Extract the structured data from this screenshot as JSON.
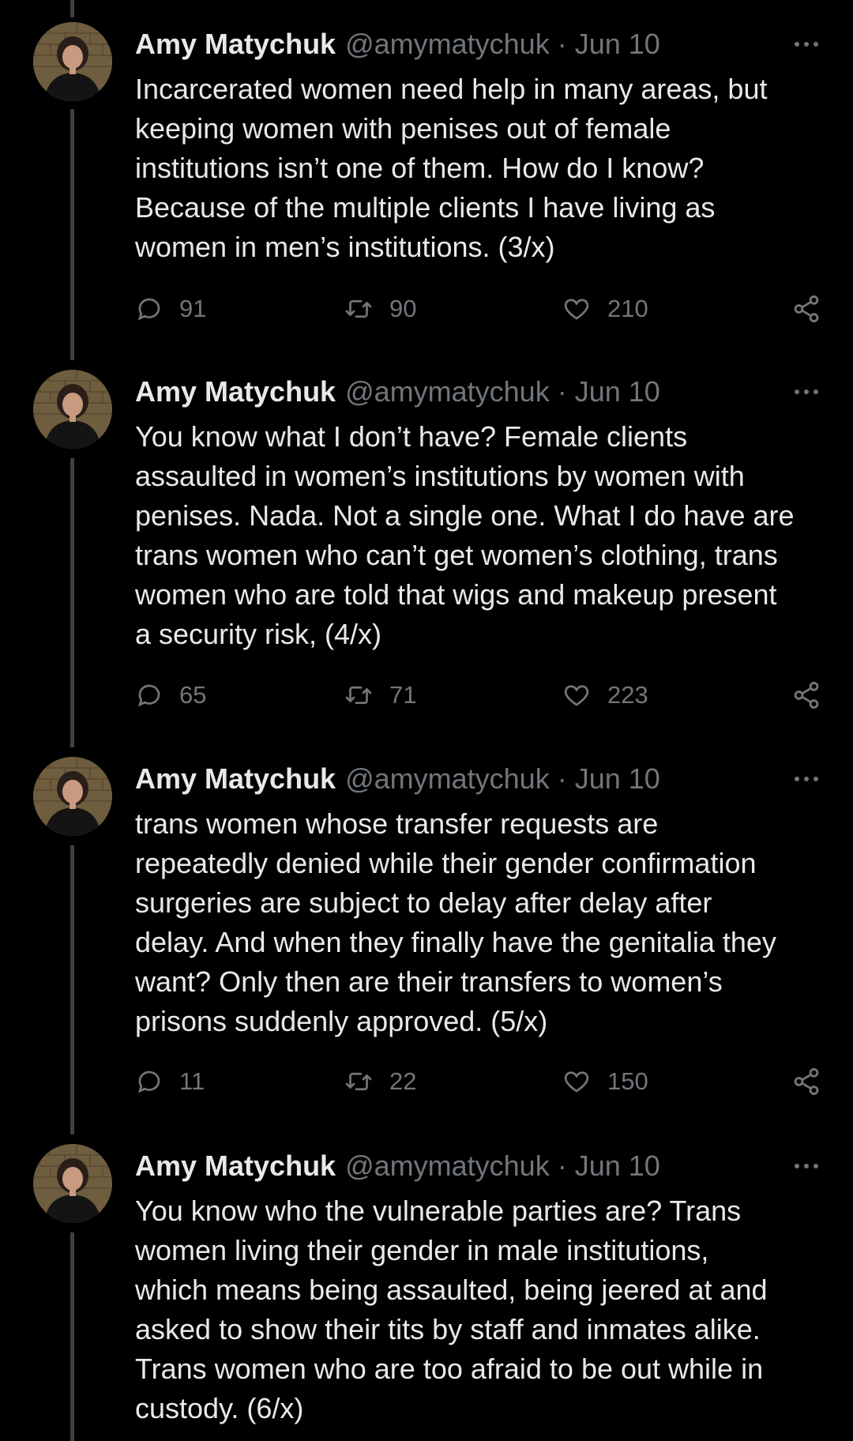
{
  "colors": {
    "background": "#000000",
    "text_primary": "#e7e9ea",
    "text_secondary": "#71767b",
    "thread_line": "#3e4144"
  },
  "icons": {
    "reply": "reply-bubble-icon",
    "retweet": "retweet-arrows-icon",
    "like": "heart-icon",
    "share": "share-nodes-icon",
    "more": "more-dots-icon"
  },
  "tweets": [
    {
      "author_name": "Amy Matychuk",
      "handle": "@amymatychuk",
      "separator": "·",
      "date": "Jun 10",
      "text": "Incarcerated women need help in many areas, but\nkeeping women with penises out of female\ninstitutions isn’t one of them. How do I know?\nBecause of the multiple clients I have living as\nwomen in men’s institutions. (3/x)",
      "replies": "91",
      "retweets": "90",
      "likes": "210"
    },
    {
      "author_name": "Amy Matychuk",
      "handle": "@amymatychuk",
      "separator": "·",
      "date": "Jun 10",
      "text": "You know what I don’t have? Female clients\nassaulted in women’s institutions by women with\npenises. Nada. Not a single one. What I do have are\ntrans women who can’t get women’s clothing, trans\nwomen who are told that wigs and makeup present\na security risk, (4/x)",
      "replies": "65",
      "retweets": "71",
      "likes": "223"
    },
    {
      "author_name": "Amy Matychuk",
      "handle": "@amymatychuk",
      "separator": "·",
      "date": "Jun 10",
      "text": "trans women whose transfer requests are\nrepeatedly denied while their gender confirmation\nsurgeries are subject to delay after delay after\ndelay. And when they finally have the genitalia they\nwant? Only then are their transfers to women’s\nprisons suddenly approved. (5/x)",
      "replies": "11",
      "retweets": "22",
      "likes": "150"
    },
    {
      "author_name": "Amy Matychuk",
      "handle": "@amymatychuk",
      "separator": "·",
      "date": "Jun 10",
      "text": "You know who the vulnerable parties are? Trans\nwomen living their gender in male institutions,\nwhich means being assaulted, being jeered at and\nasked to show their tits by staff and inmates alike.\nTrans women who are too afraid to be out while in\ncustody. (6/x)"
    }
  ]
}
